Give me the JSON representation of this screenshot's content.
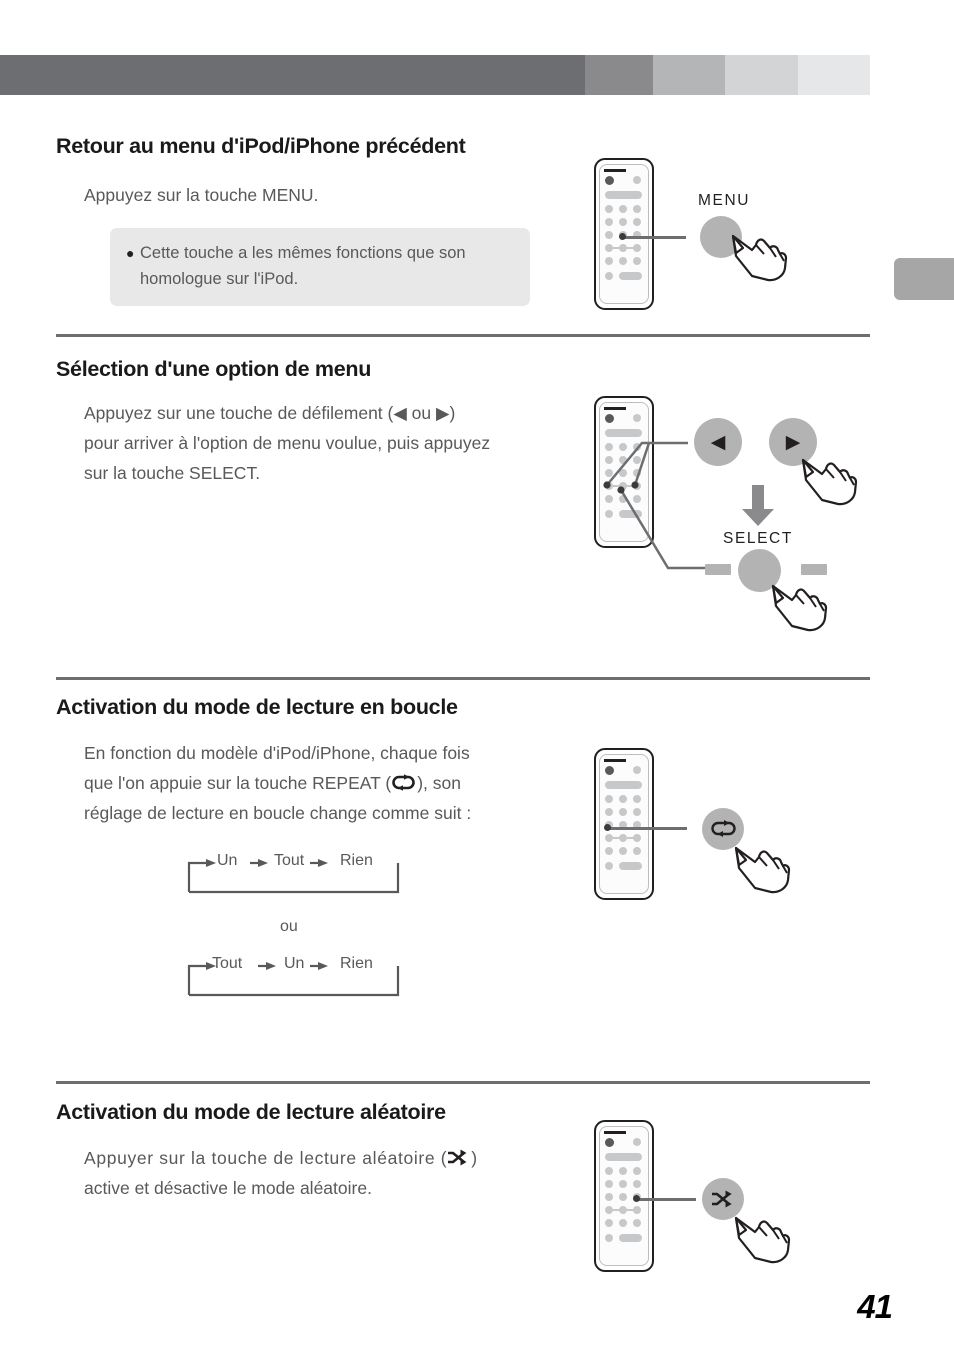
{
  "header": {
    "segments": [
      "#6d6e71",
      "#8a8a8c",
      "#b4b5b6",
      "#d3d4d5",
      "#e6e7e8"
    ]
  },
  "edge_tab": {
    "color": "#a6a6a6"
  },
  "sections": [
    {
      "id": "menu-return",
      "title": "Retour au menu d'iPod/iPhone précédent",
      "body": "Appuyez sur la touche MENU.",
      "note": {
        "bullet": "●",
        "line1": "Cette touche a les mêmes fonctions que son",
        "line2": "homologue sur l'iPod."
      },
      "callout_label": "MENU"
    },
    {
      "id": "menu-select",
      "title": "Sélection d'une option de menu",
      "body_line1": "Appuyez sur une touche de défilement (◀ ou ▶)",
      "body_line2": "pour arriver à l'option de menu voulue, puis appuyez",
      "body_line3": "sur la touche SELECT.",
      "callout_label": "SELECT",
      "left_arrow": "◀",
      "right_arrow": "▶"
    },
    {
      "id": "repeat-mode",
      "title": "Activation du mode de lecture en boucle",
      "body_line1": "En fonction du modèle d'iPod/iPhone, chaque fois",
      "body_line2_a": "que l'on appuie sur la touche REPEAT (",
      "body_line2_b": "), son",
      "body_line3": "réglage de lecture en boucle change comme suit :",
      "flow_1": [
        "Un",
        "Tout",
        "Rien"
      ],
      "or_label": "ou",
      "flow_2": [
        "Tout",
        "Un",
        "Rien"
      ]
    },
    {
      "id": "shuffle-mode",
      "title": "Activation du mode de lecture aléatoire",
      "body_line1_a": "Appuyer sur la touche de lecture aléatoire (",
      "body_line1_b": ")",
      "body_line2": "active et désactive le mode aléatoire."
    }
  ],
  "icons": {
    "repeat": "repeat-loop-icon",
    "shuffle": "shuffle-icon",
    "hand": "pointing-hand-cursor",
    "down_arrow": "down-arrow-icon"
  },
  "page_number": "41"
}
